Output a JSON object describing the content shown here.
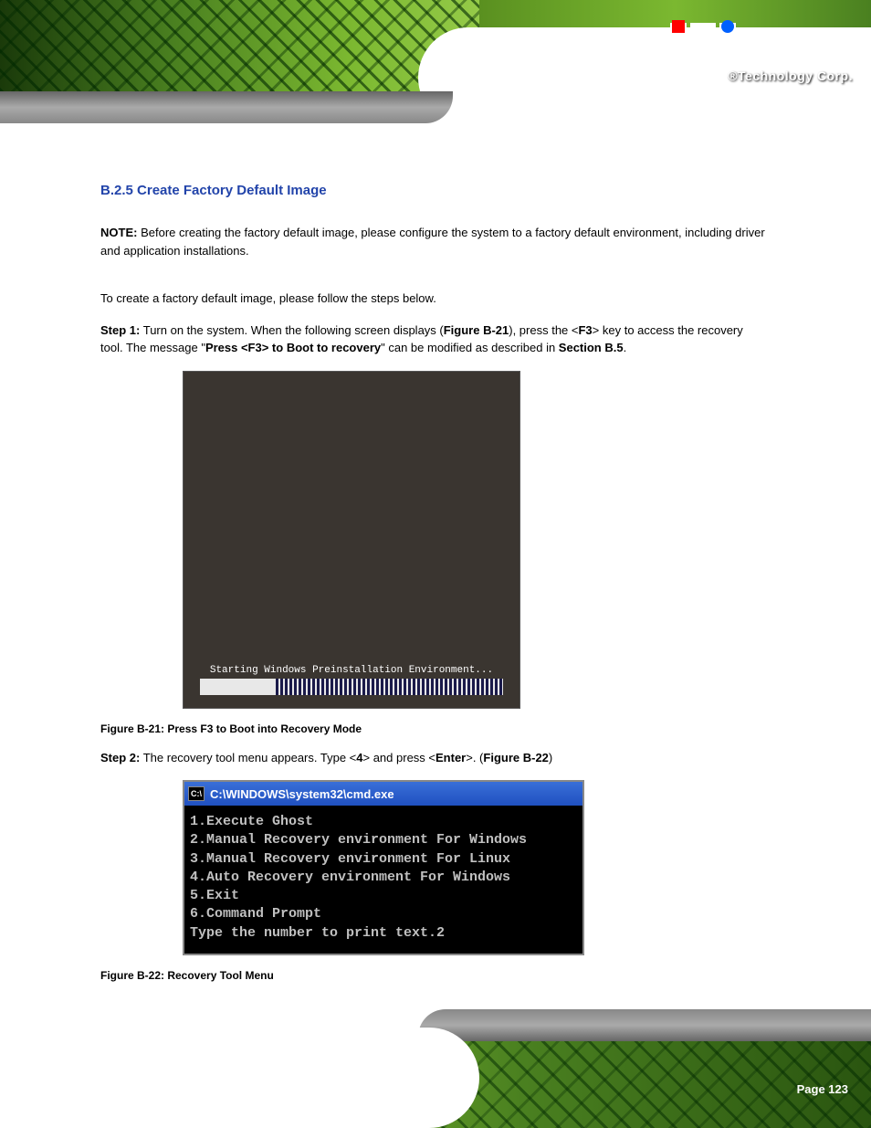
{
  "header": {
    "company_text": "®Technology Corp."
  },
  "section": {
    "title": "B.2.5  Create Factory Default Image",
    "note_label": "NOTE:",
    "note_text": "Before creating the factory default image, please configure the system to a factory default environment, including driver and application installations.",
    "intro_text": "To create a factory default image, please follow the steps below.",
    "step1_label": "Step 1:",
    "step1_text_a": "Turn on the system. When the following screen displays (",
    "step1_figure_ref": "Figure B-21",
    "step1_text_b": "), press the <",
    "step1_key": "F3",
    "step1_text_c": "> key to access the recovery tool. The message \"",
    "step1_msg": "Press <F3> to Boot to recovery",
    "step1_text_d": "\" can be modified as described in ",
    "step1_section_ref": "Section B.5",
    "step1_text_e": "."
  },
  "figure1": {
    "winpe_text": "Starting Windows Preinstallation Environment...",
    "caption": "Figure B-21: Press F3 to Boot into Recovery Mode"
  },
  "step2": {
    "label": "Step 2:",
    "text_a": "The recovery tool menu appears. Type <",
    "key": "4",
    "text_b": "> and press <",
    "key2": "Enter",
    "text_c": ">. (",
    "figure_ref": "Figure B-22",
    "text_d": ")"
  },
  "cmd": {
    "title": "C:\\WINDOWS\\system32\\cmd.exe",
    "icon_text": "C:\\",
    "line1": "1.Execute Ghost",
    "line2": "2.Manual Recovery environment For Windows",
    "line3": "3.Manual Recovery environment For Linux",
    "line4": "4.Auto Recovery environment For Windows",
    "line5": "5.Exit",
    "line6": "6.Command Prompt",
    "line7": "Type the number to print text.2"
  },
  "figure2": {
    "caption": "Figure B-22: Recovery Tool Menu"
  },
  "footer": {
    "page": "Page 123"
  }
}
